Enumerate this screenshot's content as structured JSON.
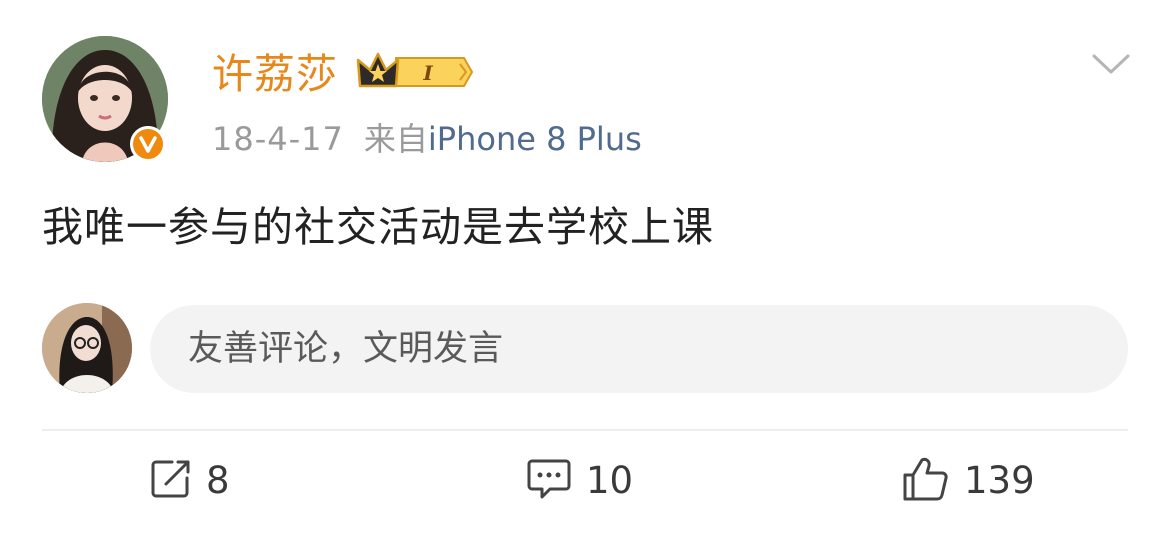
{
  "post": {
    "username": "许荔莎",
    "vip_level": "I",
    "time": "18-4-17",
    "source_prefix": "来自",
    "device": "iPhone 8 Plus",
    "text": "我唯一参与的社交活动是去学校上课"
  },
  "comment_box": {
    "placeholder": "友善评论，文明发言"
  },
  "actions": {
    "share_count": "8",
    "comment_count": "10",
    "like_count": "139"
  },
  "colors": {
    "username": "#e8881b",
    "device_link": "#516b8f",
    "verified_badge": "#f08a0f",
    "comment_box_bg": "#f3f3f3"
  },
  "icons": [
    "chevron-down-icon",
    "verified-v-icon",
    "crown-vip-icon",
    "share-icon",
    "comment-icon",
    "like-icon"
  ]
}
